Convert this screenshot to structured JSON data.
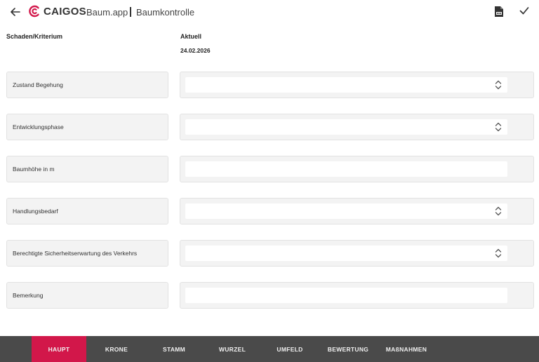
{
  "header": {
    "back_icon": "arrow-left-icon",
    "logo_text": "CAIGOS",
    "app_name": "Baum.app",
    "separator": "|",
    "title": "Baumkontrolle",
    "pdf_icon": "pdf-file-icon",
    "confirm_icon": "checkmark-icon",
    "brand_color": "#d2174a"
  },
  "columns": {
    "left_header": "Schaden/Kriterium",
    "right_header": "Aktuell",
    "date": "24.02.2026"
  },
  "rows": [
    {
      "label": "Zustand Begehung",
      "type": "select",
      "value": ""
    },
    {
      "label": "Entwicklungsphase",
      "type": "select",
      "value": ""
    },
    {
      "label": "Baumhöhe in m",
      "type": "input",
      "value": ""
    },
    {
      "label": "Handlungsbedarf",
      "type": "select",
      "value": ""
    },
    {
      "label": "Berechtigte Sicherheitserwartung des Verkehrs",
      "type": "select",
      "value": ""
    },
    {
      "label": "Bemerkung",
      "type": "input",
      "value": ""
    }
  ],
  "tabs": [
    {
      "label": "HAUPT",
      "active": true
    },
    {
      "label": "KRONE",
      "active": false
    },
    {
      "label": "STAMM",
      "active": false
    },
    {
      "label": "WURZEL",
      "active": false
    },
    {
      "label": "UMFELD",
      "active": false
    },
    {
      "label": "BEWERTUNG",
      "active": false
    },
    {
      "label": "MAßNAHMEN",
      "active": false
    }
  ]
}
